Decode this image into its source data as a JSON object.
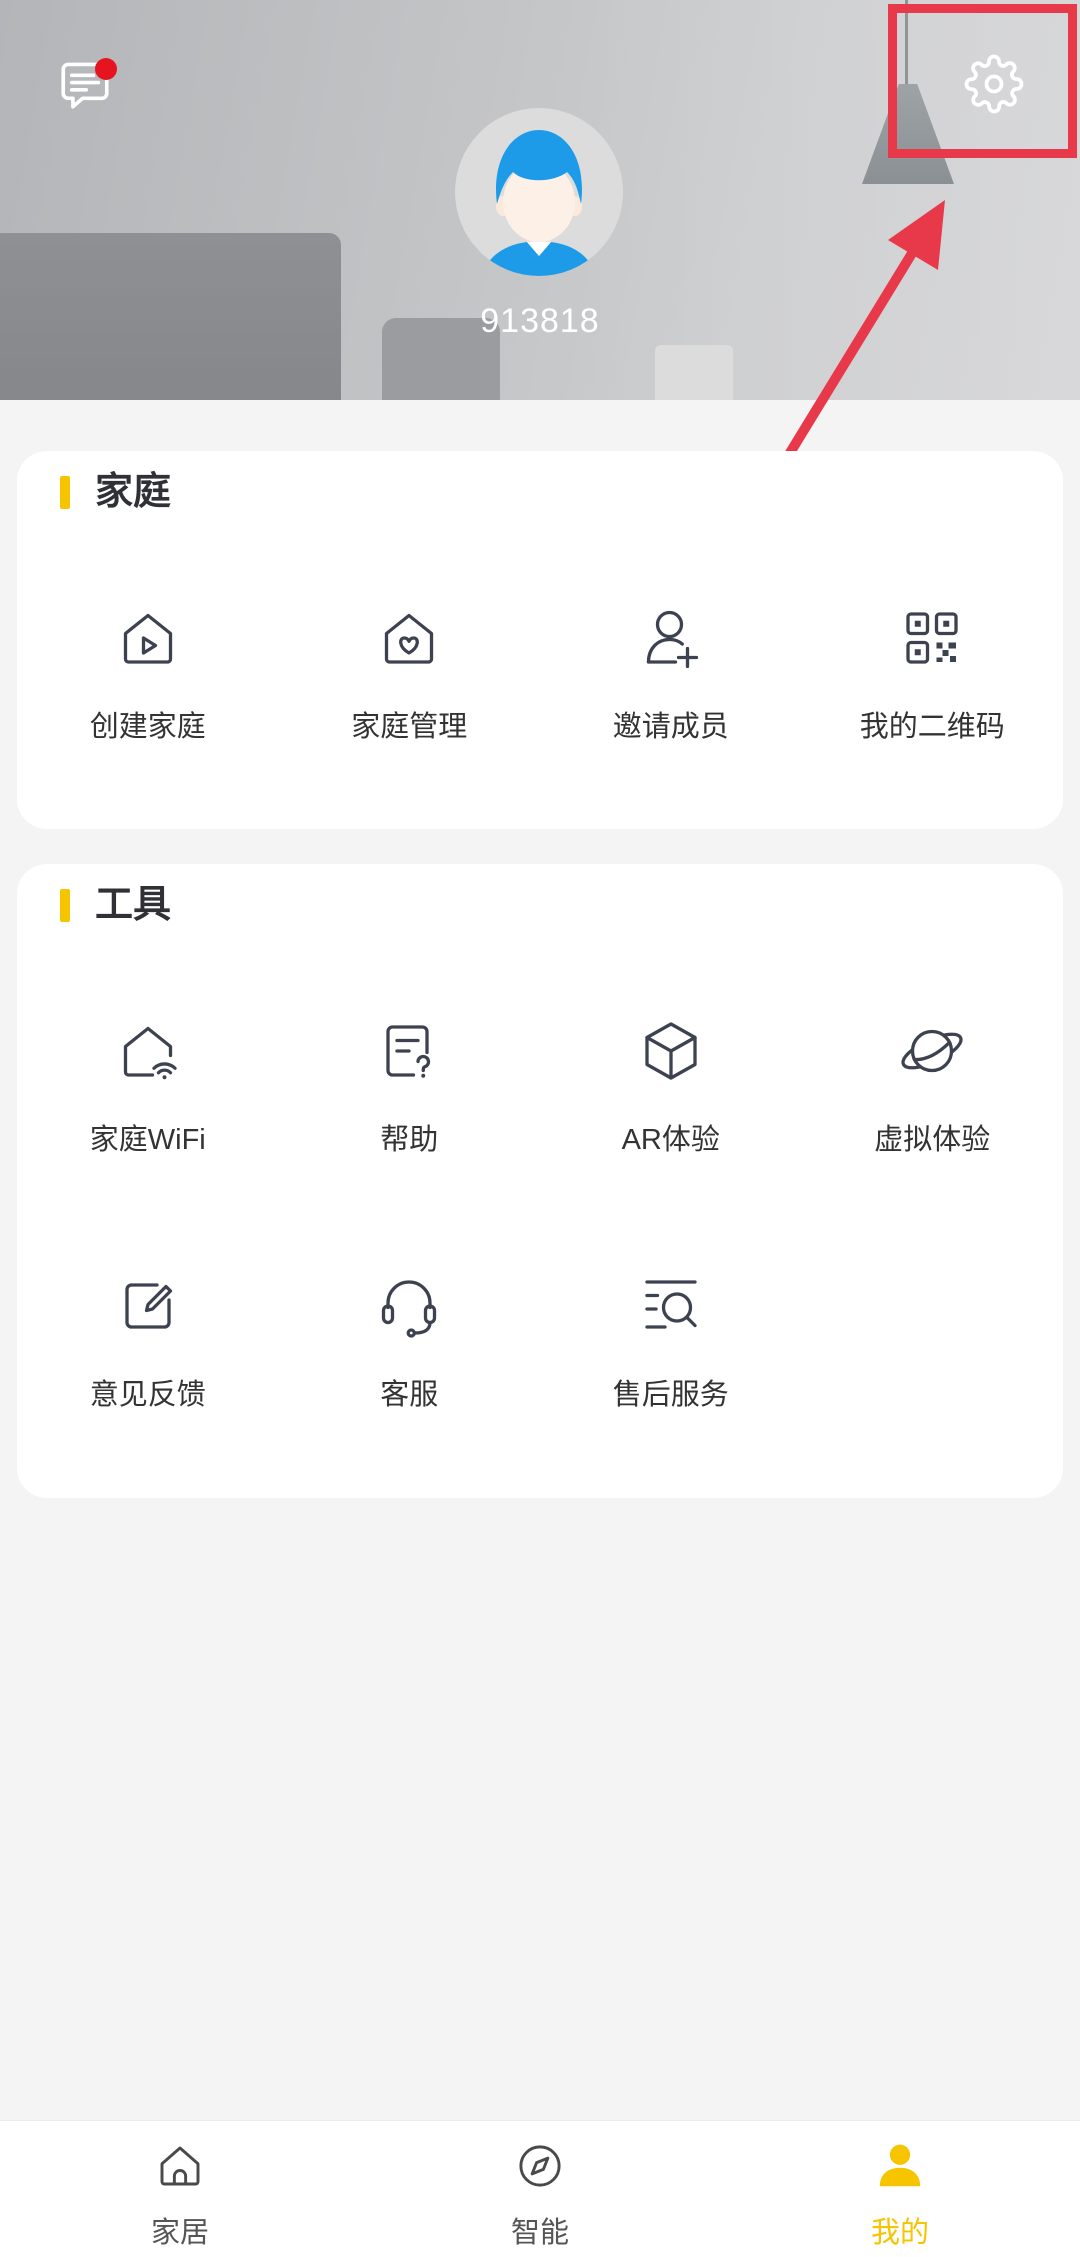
{
  "header": {
    "message_icon": "message-icon",
    "has_unread": true,
    "settings_icon": "gear-icon",
    "avatar_icon": "avatar-icon",
    "username": "913818"
  },
  "sections": [
    {
      "title": "家庭",
      "items": [
        {
          "label": "创建家庭",
          "icon": "house-play-icon"
        },
        {
          "label": "家庭管理",
          "icon": "house-heart-icon"
        },
        {
          "label": "邀请成员",
          "icon": "user-add-icon"
        },
        {
          "label": "我的二维码",
          "icon": "qr-code-icon"
        }
      ]
    },
    {
      "title": "工具",
      "items": [
        {
          "label": "家庭WiFi",
          "icon": "house-wifi-icon"
        },
        {
          "label": "帮助",
          "icon": "help-document-icon"
        },
        {
          "label": "AR体验",
          "icon": "cube-icon"
        },
        {
          "label": "虚拟体验",
          "icon": "planet-icon"
        },
        {
          "label": "意见反馈",
          "icon": "feedback-edit-icon"
        },
        {
          "label": "客服",
          "icon": "headset-icon"
        },
        {
          "label": "售后服务",
          "icon": "search-list-icon"
        }
      ]
    }
  ],
  "tab_bar": {
    "active_index": 2,
    "tabs": [
      {
        "label": "家居",
        "icon": "home-icon"
      },
      {
        "label": "智能",
        "icon": "compass-icon"
      },
      {
        "label": "我的",
        "icon": "user-icon"
      }
    ]
  },
  "colors": {
    "accent": "#f6c500",
    "annotation": "#e8394a",
    "notification_dot": "#e5141f",
    "icon_stroke": "#3d4250",
    "text": "#333333"
  }
}
